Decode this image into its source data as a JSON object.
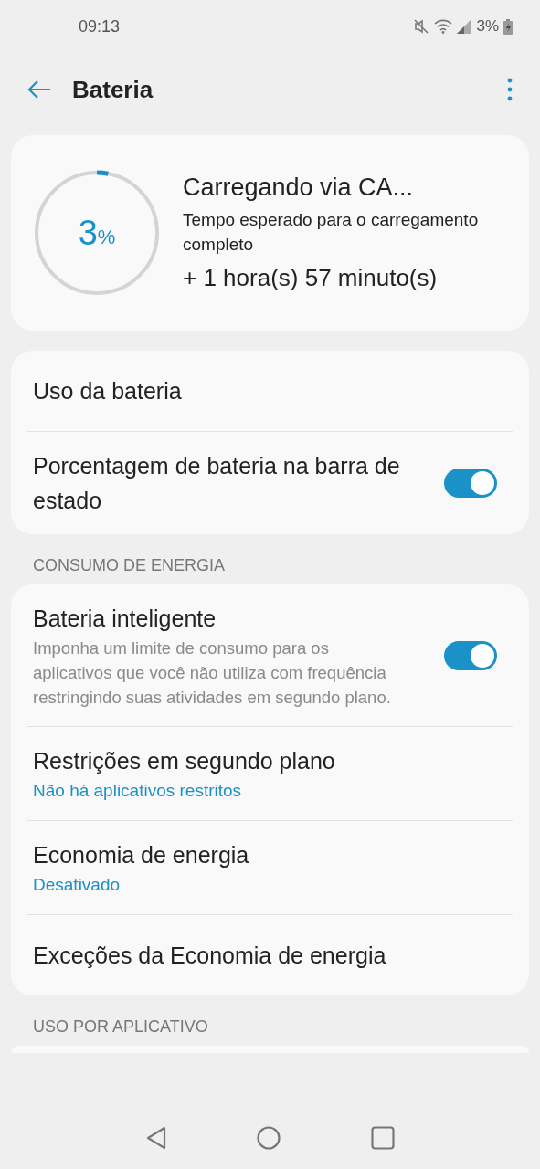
{
  "status_bar": {
    "time": "09:13",
    "battery_text": "3%"
  },
  "app_bar": {
    "title": "Bateria"
  },
  "charging": {
    "level": 0.03,
    "percent": "3",
    "percent_sign": "%",
    "title": "Carregando via CA...",
    "subtitle": "Tempo esperado para o carregamento completo",
    "remaining": "+ 1 hora(s) 57 minuto(s)"
  },
  "general": [
    {
      "kind": "plain",
      "title": "Uso da bateria"
    },
    {
      "kind": "toggle",
      "title": "Porcentagem de bateria na barra de estado",
      "on": true
    }
  ],
  "sections": [
    {
      "header": "CONSUMO DE ENERGIA",
      "items": [
        {
          "kind": "toggle",
          "title": "Bateria inteligente",
          "description": "Imponha um limite de consumo para os aplicativos que você não utiliza com frequência restringindo suas atividades em segundo plano.",
          "on": true
        },
        {
          "kind": "plain",
          "title": "Restrições em segundo plano",
          "status": "Não há aplicativos restritos"
        },
        {
          "kind": "plain",
          "title": "Economia de energia",
          "status": "Desativado"
        },
        {
          "kind": "plain",
          "title": "Exceções da Economia de energia"
        }
      ]
    },
    {
      "header": "USO POR APLICATIVO"
    }
  ]
}
